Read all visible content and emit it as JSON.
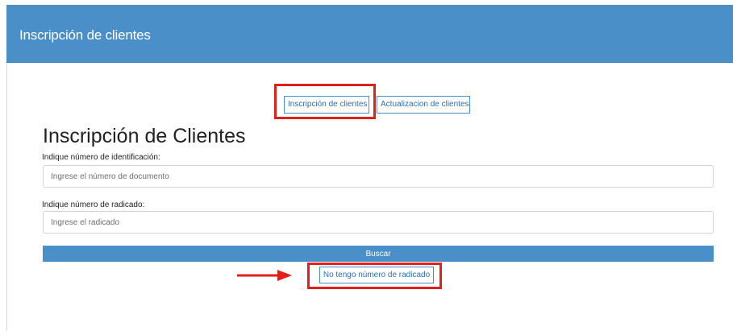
{
  "header": {
    "title": "Inscripción de clientes"
  },
  "tabs": [
    {
      "label": "Inscripción de clientes"
    },
    {
      "label": "Actualizacion de clientes"
    }
  ],
  "form": {
    "title": "Inscripción de Clientes",
    "id_label": "Indique número de identificación:",
    "id_placeholder": "Ingrese el número de documento",
    "id_value": "",
    "radicado_label": "Indique número de radicado:",
    "radicado_placeholder": "Ingrese el radicado",
    "radicado_value": "",
    "search_label": "Buscar",
    "no_radicado_label": "No tengo número de radicado"
  },
  "colors": {
    "header_bg": "#4a8fc8",
    "accent": "#4a8fc8",
    "annotation": "#e0201b"
  },
  "annotations": {
    "arrow_icon": "right-arrow-icon"
  }
}
